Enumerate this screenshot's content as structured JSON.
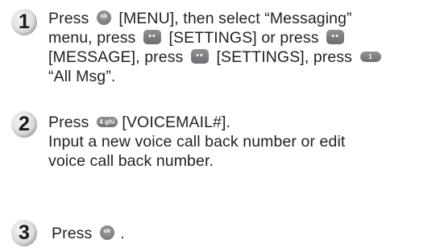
{
  "steps": [
    {
      "number": "1",
      "lines": [
        {
          "t1": "Press",
          "t2": "[MENU], then select “Messaging”"
        },
        {
          "t1": "menu, press",
          "t2": "[SETTINGS] or press"
        },
        {
          "t1": "[MESSAGE], press",
          "t2": "[SETTINGS], press"
        },
        {
          "t1": "“All Msg”."
        }
      ],
      "key_label": "1"
    },
    {
      "number": "2",
      "lines": [
        {
          "t1": "Press",
          "t2": "[VOICEMAIL#]."
        },
        {
          "t1": "Input a new voice call back number or edit"
        },
        {
          "t1": "voice call back number."
        }
      ],
      "key_label": "4 ghi"
    },
    {
      "number": "3",
      "lines": [
        {
          "t1": "Press",
          "t2": "."
        }
      ]
    }
  ],
  "icons": {
    "ok": "ok-key-icon",
    "soft": "soft-key-icon",
    "number_key": "number-key-icon"
  }
}
